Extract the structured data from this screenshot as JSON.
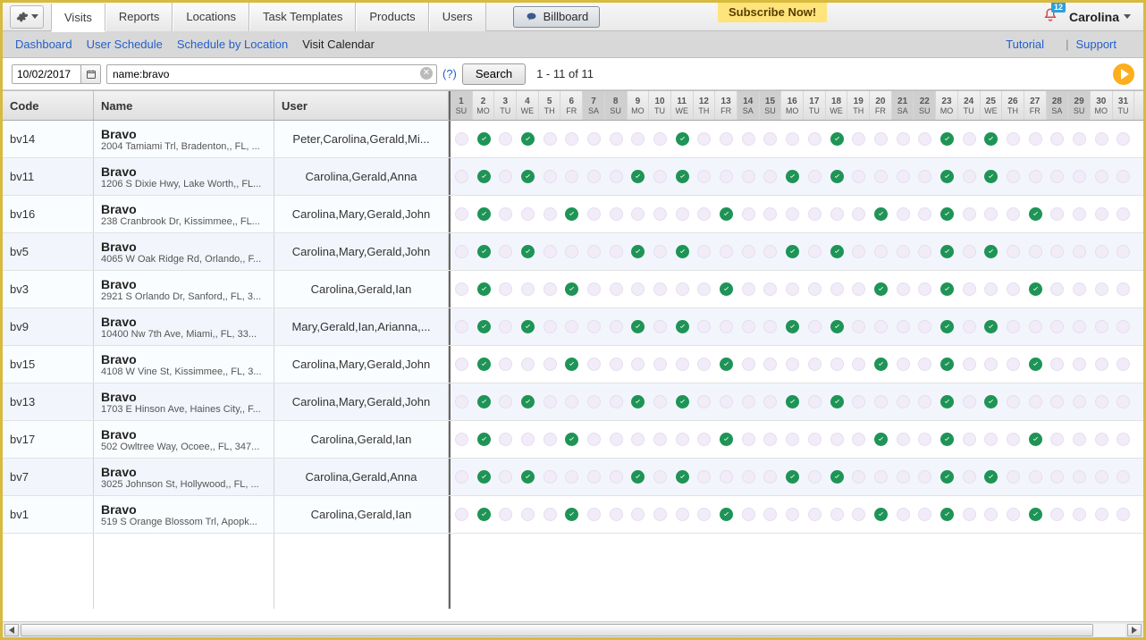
{
  "banner": {
    "subscribe": "Subscribe Now!"
  },
  "topnav": {
    "tabs": [
      "Visits",
      "Reports",
      "Locations",
      "Task Templates",
      "Products",
      "Users"
    ],
    "activeIndex": 0,
    "billboard": "Billboard"
  },
  "user": {
    "name": "Carolina",
    "notification_count": "12"
  },
  "linkbar": {
    "links": [
      "Dashboard",
      "User Schedule",
      "Schedule by Location"
    ],
    "current": "Visit Calendar",
    "tutorial": "Tutorial",
    "support": "Support"
  },
  "filter": {
    "date": "10/02/2017",
    "query": "name:bravo",
    "help": "(?)",
    "search_btn": "Search",
    "result_text": "1 - 11 of 11"
  },
  "grid": {
    "headers": {
      "code": "Code",
      "name": "Name",
      "user": "User"
    },
    "days": [
      {
        "n": "1",
        "d": "SU",
        "w": true
      },
      {
        "n": "2",
        "d": "MO"
      },
      {
        "n": "3",
        "d": "TU"
      },
      {
        "n": "4",
        "d": "WE"
      },
      {
        "n": "5",
        "d": "TH"
      },
      {
        "n": "6",
        "d": "FR"
      },
      {
        "n": "7",
        "d": "SA",
        "w": true
      },
      {
        "n": "8",
        "d": "SU",
        "w": true
      },
      {
        "n": "9",
        "d": "MO"
      },
      {
        "n": "10",
        "d": "TU"
      },
      {
        "n": "11",
        "d": "WE"
      },
      {
        "n": "12",
        "d": "TH"
      },
      {
        "n": "13",
        "d": "FR"
      },
      {
        "n": "14",
        "d": "SA",
        "w": true
      },
      {
        "n": "15",
        "d": "SU",
        "w": true
      },
      {
        "n": "16",
        "d": "MO"
      },
      {
        "n": "17",
        "d": "TU"
      },
      {
        "n": "18",
        "d": "WE"
      },
      {
        "n": "19",
        "d": "TH"
      },
      {
        "n": "20",
        "d": "FR"
      },
      {
        "n": "21",
        "d": "SA",
        "w": true
      },
      {
        "n": "22",
        "d": "SU",
        "w": true
      },
      {
        "n": "23",
        "d": "MO"
      },
      {
        "n": "24",
        "d": "TU"
      },
      {
        "n": "25",
        "d": "WE"
      },
      {
        "n": "26",
        "d": "TH"
      },
      {
        "n": "27",
        "d": "FR"
      },
      {
        "n": "28",
        "d": "SA",
        "w": true
      },
      {
        "n": "29",
        "d": "SU",
        "w": true
      },
      {
        "n": "30",
        "d": "MO"
      },
      {
        "n": "31",
        "d": "TU"
      }
    ],
    "rows": [
      {
        "code": "bv14",
        "name": "Bravo",
        "addr": "2004 Tamiami Trl, Bradenton,, FL, ...",
        "user": "Peter,Carolina,Gerald,Mi...",
        "pattern": "A"
      },
      {
        "code": "bv11",
        "name": "Bravo",
        "addr": "1206 S Dixie Hwy, Lake Worth,, FL...",
        "user": "Carolina,Gerald,Anna",
        "pattern": "B"
      },
      {
        "code": "bv16",
        "name": "Bravo",
        "addr": "238 Cranbrook Dr, Kissimmee,, FL...",
        "user": "Carolina,Mary,Gerald,John",
        "pattern": "C"
      },
      {
        "code": "bv5",
        "name": "Bravo",
        "addr": "4065 W Oak Ridge Rd, Orlando,, F...",
        "user": "Carolina,Mary,Gerald,John",
        "pattern": "B"
      },
      {
        "code": "bv3",
        "name": "Bravo",
        "addr": "2921 S Orlando Dr, Sanford,, FL, 3...",
        "user": "Carolina,Gerald,Ian",
        "pattern": "C"
      },
      {
        "code": "bv9",
        "name": "Bravo",
        "addr": "10400 Nw 7th Ave, Miami,, FL, 33...",
        "user": "Mary,Gerald,Ian,Arianna,...",
        "pattern": "B"
      },
      {
        "code": "bv15",
        "name": "Bravo",
        "addr": "4108 W Vine St, Kissimmee,, FL, 3...",
        "user": "Carolina,Mary,Gerald,John",
        "pattern": "C"
      },
      {
        "code": "bv13",
        "name": "Bravo",
        "addr": "1703 E Hinson Ave, Haines City,, F...",
        "user": "Carolina,Mary,Gerald,John",
        "pattern": "B"
      },
      {
        "code": "bv17",
        "name": "Bravo",
        "addr": "502 Owltree Way, Ocoee,, FL, 347...",
        "user": "Carolina,Gerald,Ian",
        "pattern": "C"
      },
      {
        "code": "bv7",
        "name": "Bravo",
        "addr": "3025 Johnson St, Hollywood,, FL, ...",
        "user": "Carolina,Gerald,Anna",
        "pattern": "B"
      },
      {
        "code": "bv1",
        "name": "Bravo",
        "addr": "519 S Orange Blossom Trl, Apopk...",
        "user": "Carolina,Gerald,Ian",
        "pattern": "C"
      }
    ],
    "patterns": {
      "A": [
        2,
        4,
        11,
        18,
        23,
        25
      ],
      "B": [
        2,
        4,
        9,
        11,
        16,
        18,
        23,
        25
      ],
      "C": [
        2,
        6,
        13,
        20,
        23,
        27
      ]
    }
  }
}
